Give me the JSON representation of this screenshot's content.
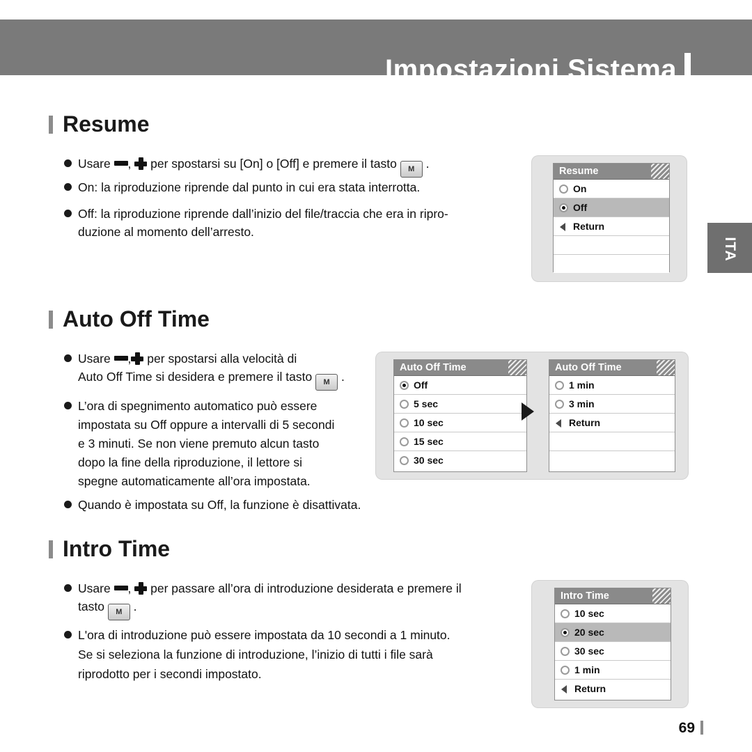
{
  "header": {
    "title": "Impostazioni Sistema"
  },
  "side_tab": {
    "label": "ITA"
  },
  "sections": [
    {
      "title": "Resume",
      "paragraphs": [
        {
          "parts": [
            "Usare ",
            ", ",
            " per spostarsi su [On] o [Off] e premere il tasto ",
            " ."
          ],
          "key_label": "M"
        },
        {
          "text": "On: la riproduzione riprende dal punto in cui era stata interrotta."
        },
        {
          "text": "Off: la riproduzione riprende dall’inizio del file/traccia che era in ripro-",
          "text2": "duzione al momento dell’arresto."
        }
      ]
    },
    {
      "title": "Auto Off Time",
      "paragraphs": [
        {
          "parts": [
            "Usare  ",
            ",",
            "  per spostarsi alla velocità di"
          ],
          "line2_a": "Auto Off Time si desidera e premere il tasto ",
          "line2_b": " .",
          "key_label": "M"
        },
        {
          "lines": [
            "L’ora di spegnimento automatico può essere",
            "impostata su Off oppure a intervalli di 5 secondi",
            "e 3 minuti. Se non viene premuto alcun tasto",
            "dopo la fine della riproduzione, il lettore si",
            "spegne automaticamente all’ora impostata."
          ]
        },
        {
          "text": "Quando è impostata su Off, la funzione è disattivata."
        }
      ]
    },
    {
      "title": "Intro Time",
      "paragraphs": [
        {
          "parts": [
            "Usare ",
            ", ",
            " per passare all’ora di introduzione desiderata e premere il"
          ],
          "line2_a": "tasto ",
          "line2_b": " .",
          "key_label": "M"
        },
        {
          "lines": [
            "L'ora di introduzione può essere impostata da 10 secondi a 1 minuto.",
            "Se si seleziona la funzione di introduzione, l’inizio di tutti i file sarà",
            "riprodotto per i secondi impostato."
          ]
        }
      ]
    }
  ],
  "screens": {
    "resume": {
      "title": "Resume",
      "items": [
        {
          "label": "On",
          "type": "radio",
          "selected": false,
          "highlight": false
        },
        {
          "label": "Off",
          "type": "radio",
          "selected": true,
          "highlight": true
        },
        {
          "label": "Return",
          "type": "return",
          "selected": false,
          "highlight": false
        },
        {
          "label": "",
          "type": "blank",
          "selected": false,
          "highlight": false
        },
        {
          "label": "",
          "type": "blank",
          "selected": false,
          "highlight": false
        }
      ]
    },
    "auto_off_left": {
      "title": "Auto Off Time",
      "items": [
        {
          "label": "Off",
          "type": "radio",
          "selected": true,
          "highlight": false
        },
        {
          "label": "5 sec",
          "type": "radio",
          "selected": false,
          "highlight": false
        },
        {
          "label": "10 sec",
          "type": "radio",
          "selected": false,
          "highlight": false
        },
        {
          "label": "15 sec",
          "type": "radio",
          "selected": false,
          "highlight": false
        },
        {
          "label": "30 sec",
          "type": "radio",
          "selected": false,
          "highlight": false
        }
      ]
    },
    "auto_off_right": {
      "title": "Auto Off Time",
      "items": [
        {
          "label": "1 min",
          "type": "radio",
          "selected": false,
          "highlight": false
        },
        {
          "label": "3 min",
          "type": "radio",
          "selected": false,
          "highlight": false
        },
        {
          "label": "Return",
          "type": "return",
          "selected": false,
          "highlight": false
        },
        {
          "label": "",
          "type": "blank",
          "selected": false,
          "highlight": false
        },
        {
          "label": "",
          "type": "blank",
          "selected": false,
          "highlight": false
        }
      ]
    },
    "intro_time": {
      "title": "Intro Time",
      "items": [
        {
          "label": "10 sec",
          "type": "radio",
          "selected": false,
          "highlight": false
        },
        {
          "label": "20 sec",
          "type": "radio",
          "selected": true,
          "highlight": true
        },
        {
          "label": "30 sec",
          "type": "radio",
          "selected": false,
          "highlight": false
        },
        {
          "label": "1 min",
          "type": "radio",
          "selected": false,
          "highlight": false
        },
        {
          "label": "Return",
          "type": "return",
          "selected": false,
          "highlight": false
        }
      ]
    }
  },
  "page_number": "69"
}
